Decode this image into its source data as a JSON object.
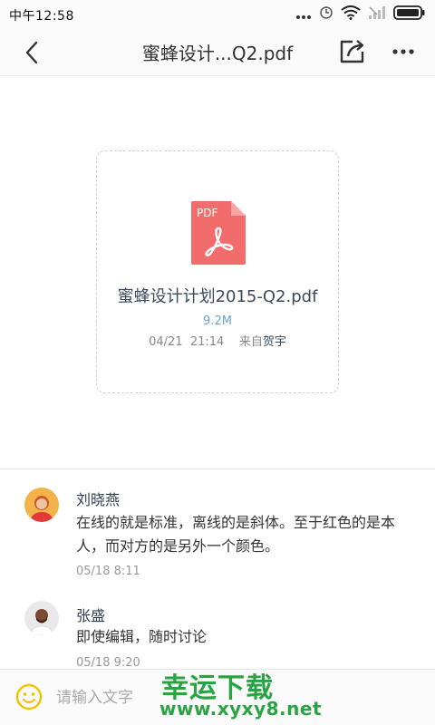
{
  "status_bar": {
    "time": "中午12:58",
    "icons": [
      "more-icon",
      "alarm-icon",
      "wifi-icon",
      "signal-icon",
      "battery-icon"
    ]
  },
  "nav": {
    "title": "蜜蜂设计...Q2.pdf",
    "icons": [
      "back-icon",
      "share-icon",
      "more-icon"
    ]
  },
  "file": {
    "icon_label": "PDF",
    "name": "蜜蜂设计计划2015-Q2.pdf",
    "size": "9.2M",
    "date": "04/21",
    "time": "21:14",
    "from_label": "来自",
    "sender": "贺宇",
    "colors": {
      "pdf_icon": "#f36c6c",
      "size_text": "#6ba0d6"
    }
  },
  "comments": [
    {
      "name": "刘晓燕",
      "text": "在线的就是标准，离线的是斜体。至于红色的是本人，而对方的是另外一个颜色。",
      "time": "05/18 8:11"
    },
    {
      "name": "张盛",
      "text": "即使编辑，随时讨论",
      "time": "05/18 9:20"
    }
  ],
  "input": {
    "placeholder": "请输入文字",
    "icon": "emoji-icon"
  },
  "watermark": {
    "title": "幸运下载",
    "url": "www.xyxy8.net",
    "color": "#2aa344"
  }
}
